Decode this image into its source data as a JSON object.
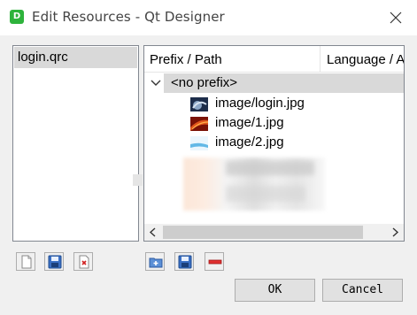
{
  "window": {
    "app_icon_letter": "D",
    "title": "Edit Resources - Qt Designer"
  },
  "resource_files": [
    {
      "name": "login.qrc",
      "selected": true
    }
  ],
  "tree": {
    "columns": [
      "Prefix / Path",
      "Language / A"
    ],
    "prefix_label": "<no prefix>",
    "files": [
      {
        "label": "image/login.jpg",
        "thumb": "login-thumbnail"
      },
      {
        "label": "image/1.jpg",
        "thumb": "red-thumbnail"
      },
      {
        "label": "image/2.jpg",
        "thumb": "blue-thumbnail"
      }
    ]
  },
  "buttons": {
    "ok": "OK",
    "cancel": "Cancel"
  },
  "icons": {
    "new_file": "new-file-icon",
    "save": "save-icon",
    "remove_file": "remove-file-icon",
    "add_prefix": "add-prefix-icon",
    "add_files": "add-files-icon",
    "remove": "remove-icon"
  },
  "colors": {
    "selection": "#d9d9d9",
    "dialog_bg": "#f0f0f0",
    "app_icon": "#2eb33c"
  }
}
